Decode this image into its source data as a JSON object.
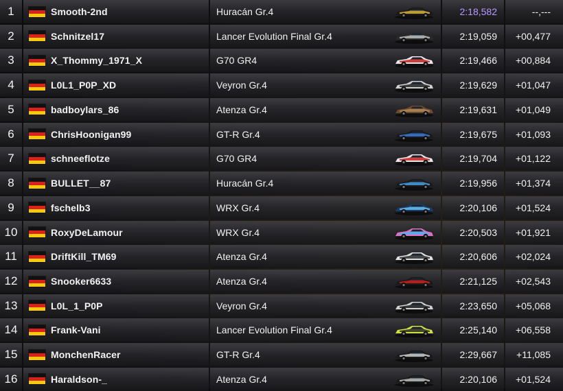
{
  "rows": [
    {
      "pos": "1",
      "driver": "Smooth-2nd",
      "car": "Huracán Gr.4",
      "time": "2:18,582",
      "gap": "--,---",
      "best": true,
      "car_colors": [
        "#1a1a1a",
        "#d9b13a"
      ]
    },
    {
      "pos": "2",
      "driver": "Schnitzel17",
      "car": "Lancer Evolution Final Gr.4",
      "time": "2:19,059",
      "gap": "+00,477",
      "best": false,
      "car_colors": [
        "#2a2a2a",
        "#c0c0c0"
      ]
    },
    {
      "pos": "3",
      "driver": "X_Thommy_1971_X",
      "car": "G70 GR4",
      "time": "2:19,466",
      "gap": "+00,884",
      "best": false,
      "car_colors": [
        "#e8e8e8",
        "#c82020"
      ]
    },
    {
      "pos": "4",
      "driver": "L0L1_P0P_XD",
      "car": "Veyron Gr.4",
      "time": "2:19,629",
      "gap": "+01,047",
      "best": false,
      "car_colors": [
        "#d0d0d0",
        "#222222"
      ]
    },
    {
      "pos": "5",
      "driver": "badboylars_86",
      "car": "Atenza Gr.4",
      "time": "2:19,631",
      "gap": "+01,049",
      "best": false,
      "car_colors": [
        "#6a4a2a",
        "#b08a5a"
      ]
    },
    {
      "pos": "6",
      "driver": "ChrisHoonigan99",
      "car": "GT-R Gr.4",
      "time": "2:19,675",
      "gap": "+01,093",
      "best": false,
      "car_colors": [
        "#1a1a1a",
        "#3a7ad8"
      ]
    },
    {
      "pos": "7",
      "driver": "schneeflotze",
      "car": "G70 GR4",
      "time": "2:19,704",
      "gap": "+01,122",
      "best": false,
      "car_colors": [
        "#e8e8e8",
        "#c82020"
      ]
    },
    {
      "pos": "8",
      "driver": "BULLET__87",
      "car": "Huracán Gr.4",
      "time": "2:19,956",
      "gap": "+01,374",
      "best": false,
      "car_colors": [
        "#1a1a1a",
        "#4aa0e0"
      ]
    },
    {
      "pos": "9",
      "driver": "fschelb3",
      "car": "WRX Gr.4",
      "time": "2:20,106",
      "gap": "+01,524",
      "best": false,
      "car_colors": [
        "#1a3a6a",
        "#6ac0f0"
      ]
    },
    {
      "pos": "10",
      "driver": "RoxyDeLamour",
      "car": "WRX Gr.4",
      "time": "2:20,503",
      "gap": "+01,921",
      "best": false,
      "car_colors": [
        "#e070c0",
        "#4ab0f0"
      ]
    },
    {
      "pos": "11",
      "driver": "DriftKill_TM69",
      "car": "Atenza Gr.4",
      "time": "2:20,606",
      "gap": "+02,024",
      "best": false,
      "car_colors": [
        "#e0e0e0",
        "#2a2a2a"
      ]
    },
    {
      "pos": "12",
      "driver": "Snooker6633",
      "car": "Atenza Gr.4",
      "time": "2:21,125",
      "gap": "+02,543",
      "best": false,
      "car_colors": [
        "#1a1a1a",
        "#d02020"
      ]
    },
    {
      "pos": "13",
      "driver": "L0L_1_P0P",
      "car": "Veyron Gr.4",
      "time": "2:23,650",
      "gap": "+05,068",
      "best": false,
      "car_colors": [
        "#d0d0d0",
        "#1a1a1a"
      ]
    },
    {
      "pos": "14",
      "driver": "Frank-Vani",
      "car": "Lancer Evolution Final Gr.4",
      "time": "2:25,140",
      "gap": "+06,558",
      "best": false,
      "car_colors": [
        "#d0e040",
        "#2a2a2a"
      ]
    },
    {
      "pos": "15",
      "driver": "MonchenRacer",
      "car": "GT-R Gr.4",
      "time": "2:29,667",
      "gap": "+11,085",
      "best": false,
      "car_colors": [
        "#1a1a1a",
        "#d0d0d0"
      ]
    },
    {
      "pos": "16",
      "driver": "Haraldson-_",
      "car": "Atenza Gr.4",
      "time": "2:20,106",
      "gap": "+01,524",
      "best": false,
      "car_colors": [
        "#1a1a1a",
        "#c0c0c0"
      ]
    }
  ],
  "colors": {
    "best_time": "#b49cff",
    "flag": [
      "#111111",
      "#d8221a",
      "#f6c80e"
    ]
  },
  "icons": {
    "flag": "germany-flag-icon",
    "car": "car-livery-icon"
  }
}
